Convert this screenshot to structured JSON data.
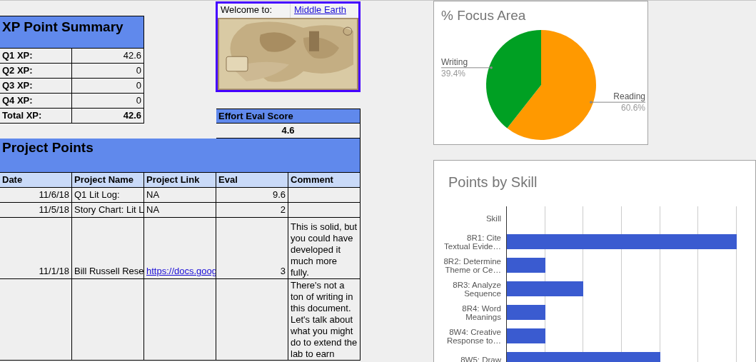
{
  "xp_summary": {
    "title": "XP Point Summary",
    "rows": [
      {
        "label": "Q1 XP:",
        "value": "42.6",
        "kind": "quarter"
      },
      {
        "label": "Q2 XP:",
        "value": "0",
        "kind": "quarter"
      },
      {
        "label": "Q3 XP:",
        "value": "0",
        "kind": "quarter"
      },
      {
        "label": "Q4 XP:",
        "value": "0",
        "kind": "quarter"
      },
      {
        "label": "Total XP:",
        "value": "42.6",
        "kind": "total"
      }
    ]
  },
  "welcome": {
    "label": "Welcome to:",
    "link": "Middle Earth"
  },
  "effort_eval": {
    "title": "Effort Eval Score",
    "value": "4.6"
  },
  "project_points": {
    "title": "Project Points",
    "columns": [
      "Date",
      "Project Name",
      "Project Link",
      "Eval",
      "Comment"
    ],
    "rows": [
      {
        "date": "11/6/18",
        "name": "Q1 Lit Log:",
        "link": {
          "kind": "text",
          "text": "NA"
        },
        "eval": "9.6"
      },
      {
        "date": "11/5/18",
        "name": "Story Chart: Lit L",
        "link": {
          "kind": "text",
          "text": "NA"
        },
        "eval": "2"
      },
      {
        "date": "11/1/18",
        "name": "Bill Russell Rese",
        "link": {
          "kind": "link",
          "text": "https://docs.goog"
        },
        "eval": "3",
        "comment": "This is solid, but you could have developed it much more fully."
      },
      {
        "comment": "There's not a ton of writing in this document. Let's talk about what you might do to extend the lab to earn"
      }
    ]
  },
  "focus_chart": {
    "chart_data": {
      "type": "pie",
      "title": "% Focus Area",
      "categories": [
        "Reading",
        "Writing"
      ],
      "values": [
        60.6,
        39.4
      ],
      "colors": [
        "#ff9900",
        "#00a023"
      ],
      "value_labels": [
        "60.6%",
        "39.4%"
      ]
    }
  },
  "skill_chart": {
    "title": "Points by Skill",
    "categories": [
      "Skill",
      "8R1: Cite\nTextual Evide…",
      "8R2: Determine\nTheme or Ce…",
      "8R3: Analyze\nSequence",
      "8R4: Word\nMeanings",
      "8W4: Creative\nResponse to…",
      "8W5: Draw"
    ]
  }
}
